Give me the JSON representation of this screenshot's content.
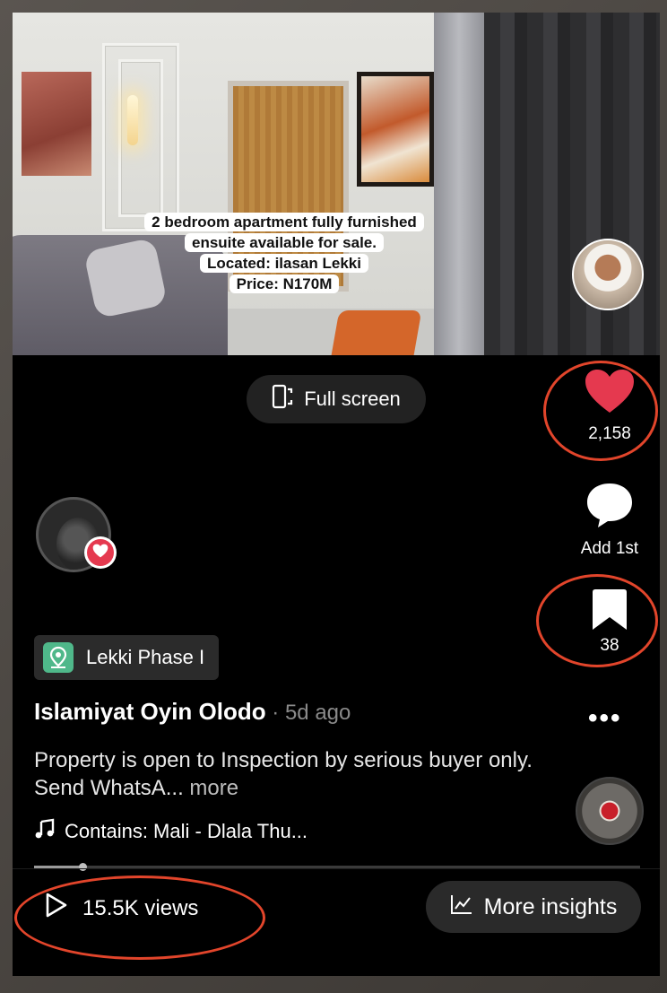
{
  "video": {
    "caption_lines": [
      "2 bedroom apartment fully furnished",
      "ensuite available for sale.",
      "Located: ilasan Lekki",
      "Price: N170M"
    ]
  },
  "fullscreen": {
    "label": "Full screen"
  },
  "actions": {
    "like_count": "2,158",
    "comment_label": "Add 1st",
    "save_count": "38"
  },
  "location": {
    "label": "Lekki Phase I"
  },
  "post": {
    "author": "Islamiyat Oyin Olodo",
    "separator": " · ",
    "age": "5d ago",
    "description": "Property is open to Inspection by serious buyer only. Send WhatsA...",
    "more_label": " more",
    "music": "Contains: Mali - Dlala Thu...",
    "progress": 0.08
  },
  "footer": {
    "views": "15.5K views",
    "insights_label": "More insights"
  },
  "colors": {
    "like": "#e5394f",
    "annotation": "#e2452b",
    "location_icon": "#4fb88a"
  }
}
